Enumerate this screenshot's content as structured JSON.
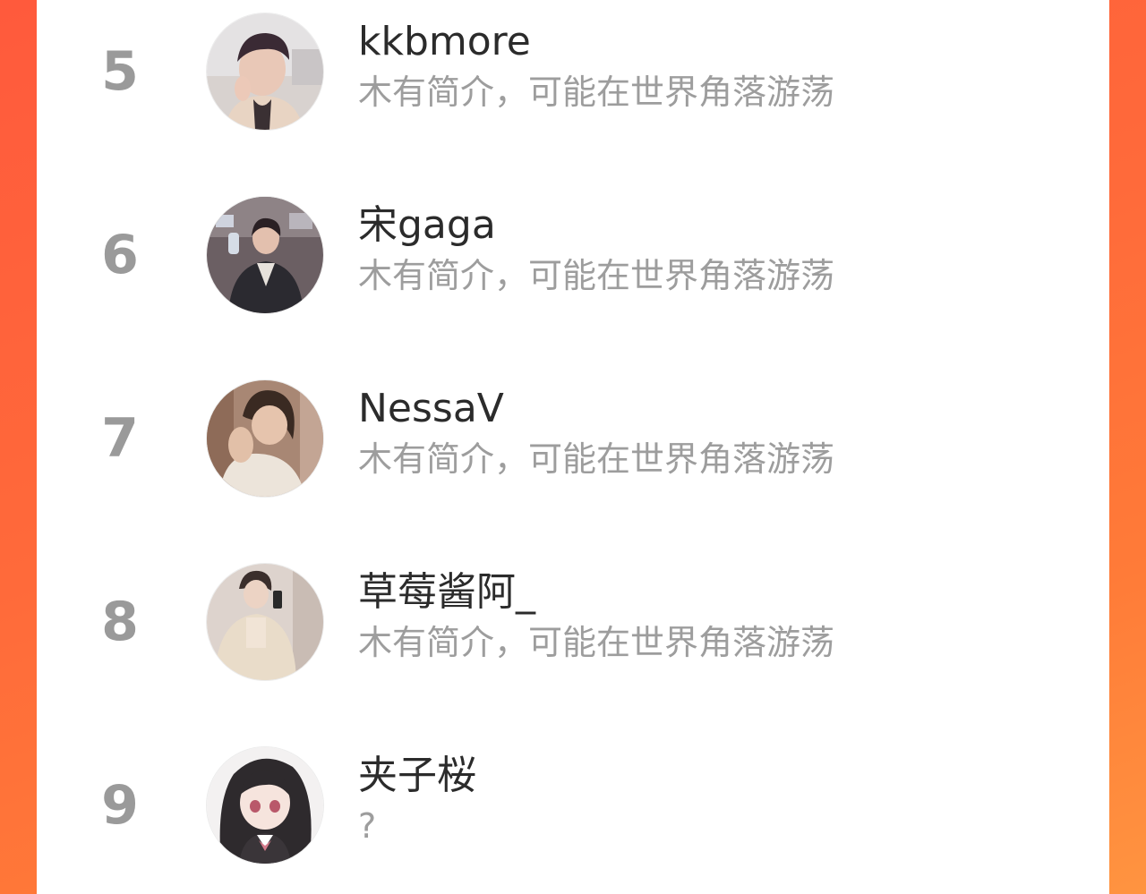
{
  "colors": {
    "background_gradient_start": "#ff5a3c",
    "background_gradient_end": "#ff9440",
    "panel": "#ffffff",
    "rank_text": "#9a9a9a",
    "name_text": "#2b2b2b",
    "bio_text": "#9d9d9d"
  },
  "ranking": {
    "items": [
      {
        "rank": "5",
        "name": "kkbmore",
        "bio": "木有简介，可能在世界角落游荡",
        "avatar_icon": "user-photo-icon"
      },
      {
        "rank": "6",
        "name": "宋gaga",
        "bio": "木有简介，可能在世界角落游荡",
        "avatar_icon": "user-photo-icon"
      },
      {
        "rank": "7",
        "name": "NessaV",
        "bio": "木有简介，可能在世界角落游荡",
        "avatar_icon": "user-photo-icon"
      },
      {
        "rank": "8",
        "name": "草莓酱阿_",
        "bio": "木有简介，可能在世界角落游荡",
        "avatar_icon": "user-photo-icon"
      },
      {
        "rank": "9",
        "name": "夹子桜",
        "bio": "?",
        "avatar_icon": "anime-avatar-icon"
      }
    ]
  }
}
